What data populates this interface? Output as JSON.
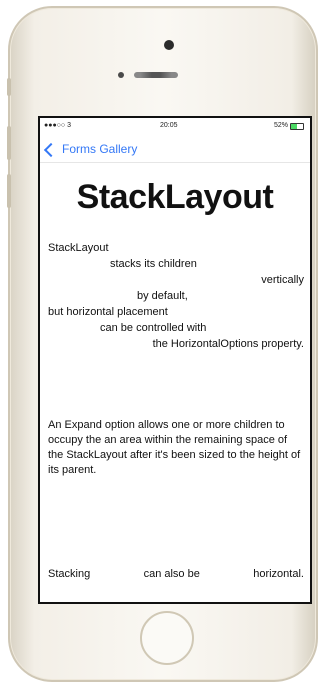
{
  "status": {
    "carrier": "●●●○○ 3",
    "time": "20:05",
    "battery_text": "52%",
    "battery_level": 0.52
  },
  "nav": {
    "back_label": "Forms Gallery"
  },
  "page": {
    "title": "StackLayout",
    "stack_lines": [
      "StackLayout",
      "stacks its children",
      "vertically",
      "by default,",
      "but horizontal placement",
      "can be controlled with",
      "the HorizontalOptions property."
    ],
    "expand_text": "An Expand option allows one or more children to occupy the an area within the remaining space of the StackLayout after it's been sized to the height of its parent.",
    "horizontal_words": [
      "Stacking",
      "can also be",
      "horizontal."
    ]
  }
}
